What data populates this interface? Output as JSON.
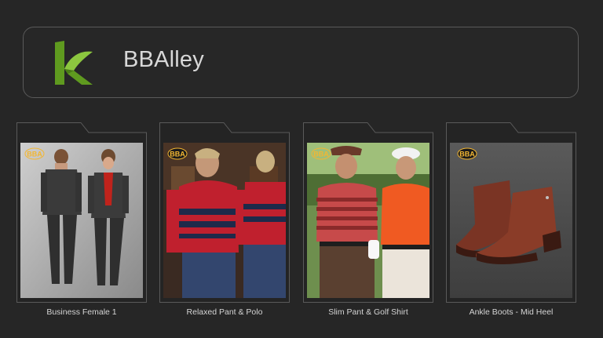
{
  "header": {
    "brand_name": "BBAlley",
    "logo_icon": "bballey-k-logo-icon",
    "logo_colors": [
      "#5a8f1e",
      "#8cc63f"
    ]
  },
  "products": [
    {
      "name": "Business Female 1",
      "badge": "BBA"
    },
    {
      "name": "Relaxed Pant & Polo",
      "badge": "BBA"
    },
    {
      "name": "Slim Pant & Golf Shirt",
      "badge": "BBA"
    },
    {
      "name": "Ankle Boots - Mid Heel",
      "badge": "BBA"
    }
  ],
  "colors": {
    "background": "#262626",
    "border": "#5a5a5a",
    "badge_gold": "#f2b632"
  }
}
